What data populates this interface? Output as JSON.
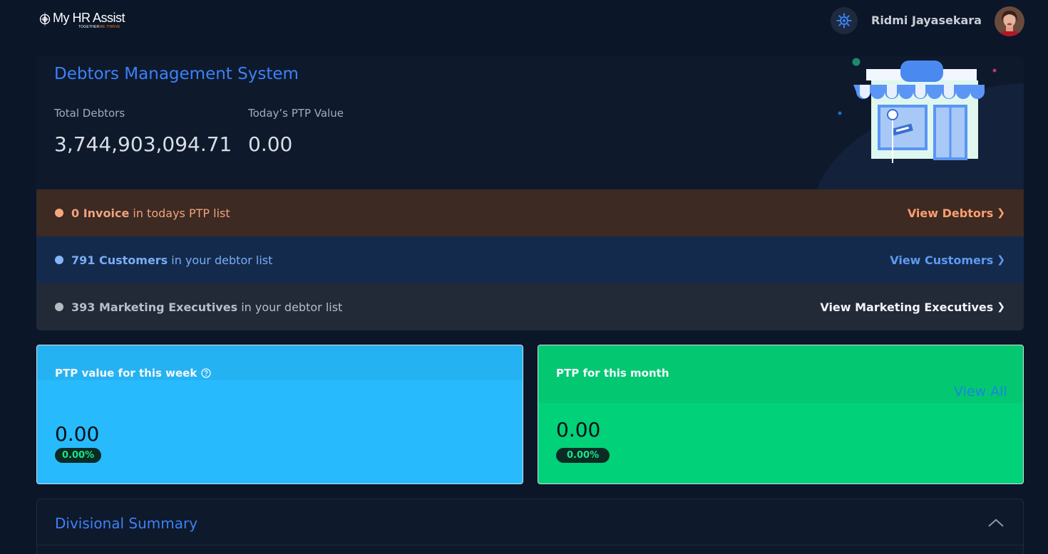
{
  "app": {
    "logo_title": "My HR Assist",
    "logo_tagline_1": "TOGETHER",
    "logo_tagline_2": "WE THRIVE",
    "user_name": "Ridmi Jayasekara"
  },
  "hero": {
    "title": "Debtors Management System",
    "stats": [
      {
        "label": "Total Debtors",
        "value": "3,744,903,094.71"
      },
      {
        "label": "Today’s PTP Value",
        "value": "0.00"
      }
    ]
  },
  "rows": {
    "invoice": {
      "bold": "0 Invoice",
      "text": " in todays PTP list",
      "link": "View Debtors"
    },
    "customers": {
      "bold": "791 Customers",
      "text": " in your debtor list",
      "link": "View Customers"
    },
    "executives": {
      "bold": "393 Marketing Executives",
      "text": " in your debtor list",
      "link": "View Marketing Executives"
    }
  },
  "ptp": {
    "week": {
      "title": "PTP value for this week",
      "value": "0.00",
      "change": "0.00%"
    },
    "month": {
      "title": "PTP for this month",
      "link": "View All",
      "value": "0.00",
      "change": "0.00%"
    }
  },
  "summary": {
    "title": "Divisional Summary"
  },
  "colors": {
    "background": "#0b1628",
    "accent_blue": "#3b82f6",
    "week_card": "#27bbfd",
    "month_card": "#01d178",
    "invoice_row": "#3c2a23",
    "customers_row": "#142a4d",
    "executives_row": "#222937"
  }
}
